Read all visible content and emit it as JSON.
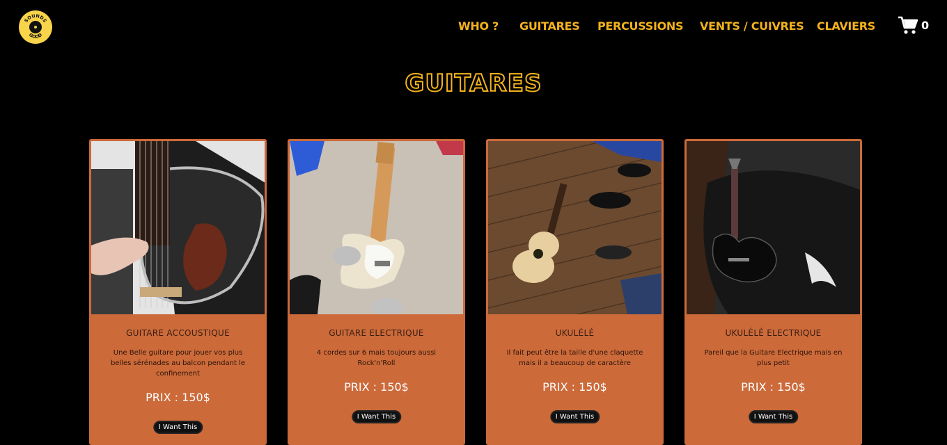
{
  "header": {
    "logo_text": "SOUNDS GOOD",
    "nav": [
      {
        "label": "WHO ?"
      },
      {
        "label": "GUITARES"
      },
      {
        "label": "PERCUSSIONS"
      },
      {
        "label": "VENTS / CUIVRES"
      },
      {
        "label": "CLAVIERS"
      }
    ],
    "cart_count": "0"
  },
  "page_title": "GUITARES",
  "colors": {
    "accent": "#f2b21c",
    "card": "#cc6a3a",
    "background": "#000000"
  },
  "products": [
    {
      "name": "GUITARE ACCOUSTIQUE",
      "description": "Une Belle guitare pour jouer vos plus belles sérénades au balcon pendant le confinement",
      "price": "PRIX : 150$",
      "button": "I Want This"
    },
    {
      "name": "GUITARE ELECTRIQUE",
      "description": "4 cordes sur 6 mais toujours aussi Rock'n'Roll",
      "price": "PRIX : 150$",
      "button": "I Want This"
    },
    {
      "name": "UKULÉLÉ",
      "description": "Il fait peut être la taille d'une claquette mais il a beaucoup de caractère",
      "price": "PRIX : 150$",
      "button": "I Want This"
    },
    {
      "name": "UKULÉLÉ ELECTRIQUE",
      "description": "Pareil que la Guitare Electrique mais en plus petit",
      "price": "PRIX : 150$",
      "button": "I Want This"
    }
  ]
}
